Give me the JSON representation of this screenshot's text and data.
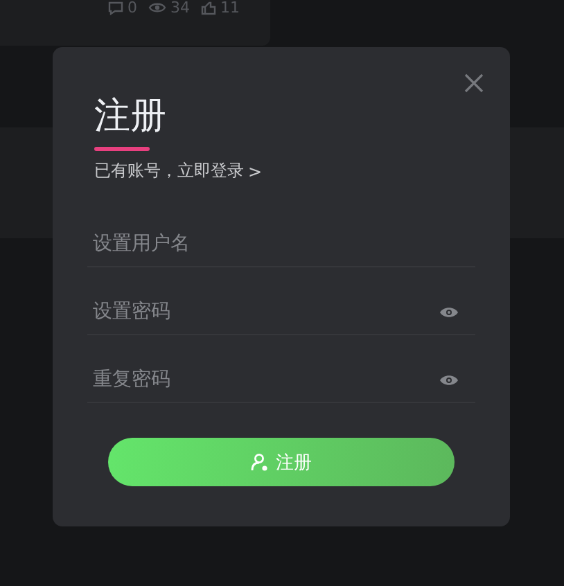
{
  "background_post": {
    "stats": [
      {
        "kind": "comments",
        "count": "0"
      },
      {
        "kind": "views",
        "count": "34"
      },
      {
        "kind": "likes",
        "count": "11"
      }
    ]
  },
  "dialog": {
    "title": "注册",
    "login_link": "已有账号，立即登录",
    "login_arrow": ">",
    "fields": [
      {
        "kind": "text",
        "placeholder": "设置用户名"
      },
      {
        "kind": "password",
        "placeholder": "设置密码"
      },
      {
        "kind": "password",
        "placeholder": "重复密码"
      }
    ],
    "submit_button": "注册"
  }
}
